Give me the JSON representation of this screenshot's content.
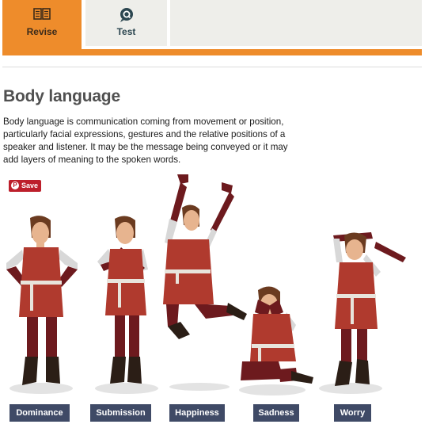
{
  "tabs": [
    {
      "id": "revise",
      "label": "Revise",
      "icon": "book-icon",
      "active": true
    },
    {
      "id": "test",
      "label": "Test",
      "icon": "quiz-icon",
      "active": false
    }
  ],
  "colors": {
    "accent": "#ee8c2b",
    "tab_inactive": "#eeeeea",
    "caption_bg": "#3f4a66",
    "save_button": "#bd1f2b",
    "tunic": "#b03a2e",
    "skin": "#e7b48f"
  },
  "content": {
    "title": "Body language",
    "intro": "Body language is communication coming from movement or position, particularly facial expressions, gestures and the relative positions of a speaker and listener. It may be the message being conveyed or it may add layers of meaning to the spoken words."
  },
  "save_button": {
    "label": "Save",
    "icon": "pinterest-icon"
  },
  "figures": [
    {
      "name": "dominance",
      "caption": "Dominance",
      "pose": "hands on hips"
    },
    {
      "name": "submission",
      "caption": "Submission",
      "pose": "arms crossed, shy"
    },
    {
      "name": "happiness",
      "caption": "Happiness",
      "pose": "jumping with arms raised"
    },
    {
      "name": "sadness",
      "caption": "Sadness",
      "pose": "kneeling, face in hands"
    },
    {
      "name": "worry",
      "caption": "Worry",
      "pose": "hands on head"
    }
  ]
}
